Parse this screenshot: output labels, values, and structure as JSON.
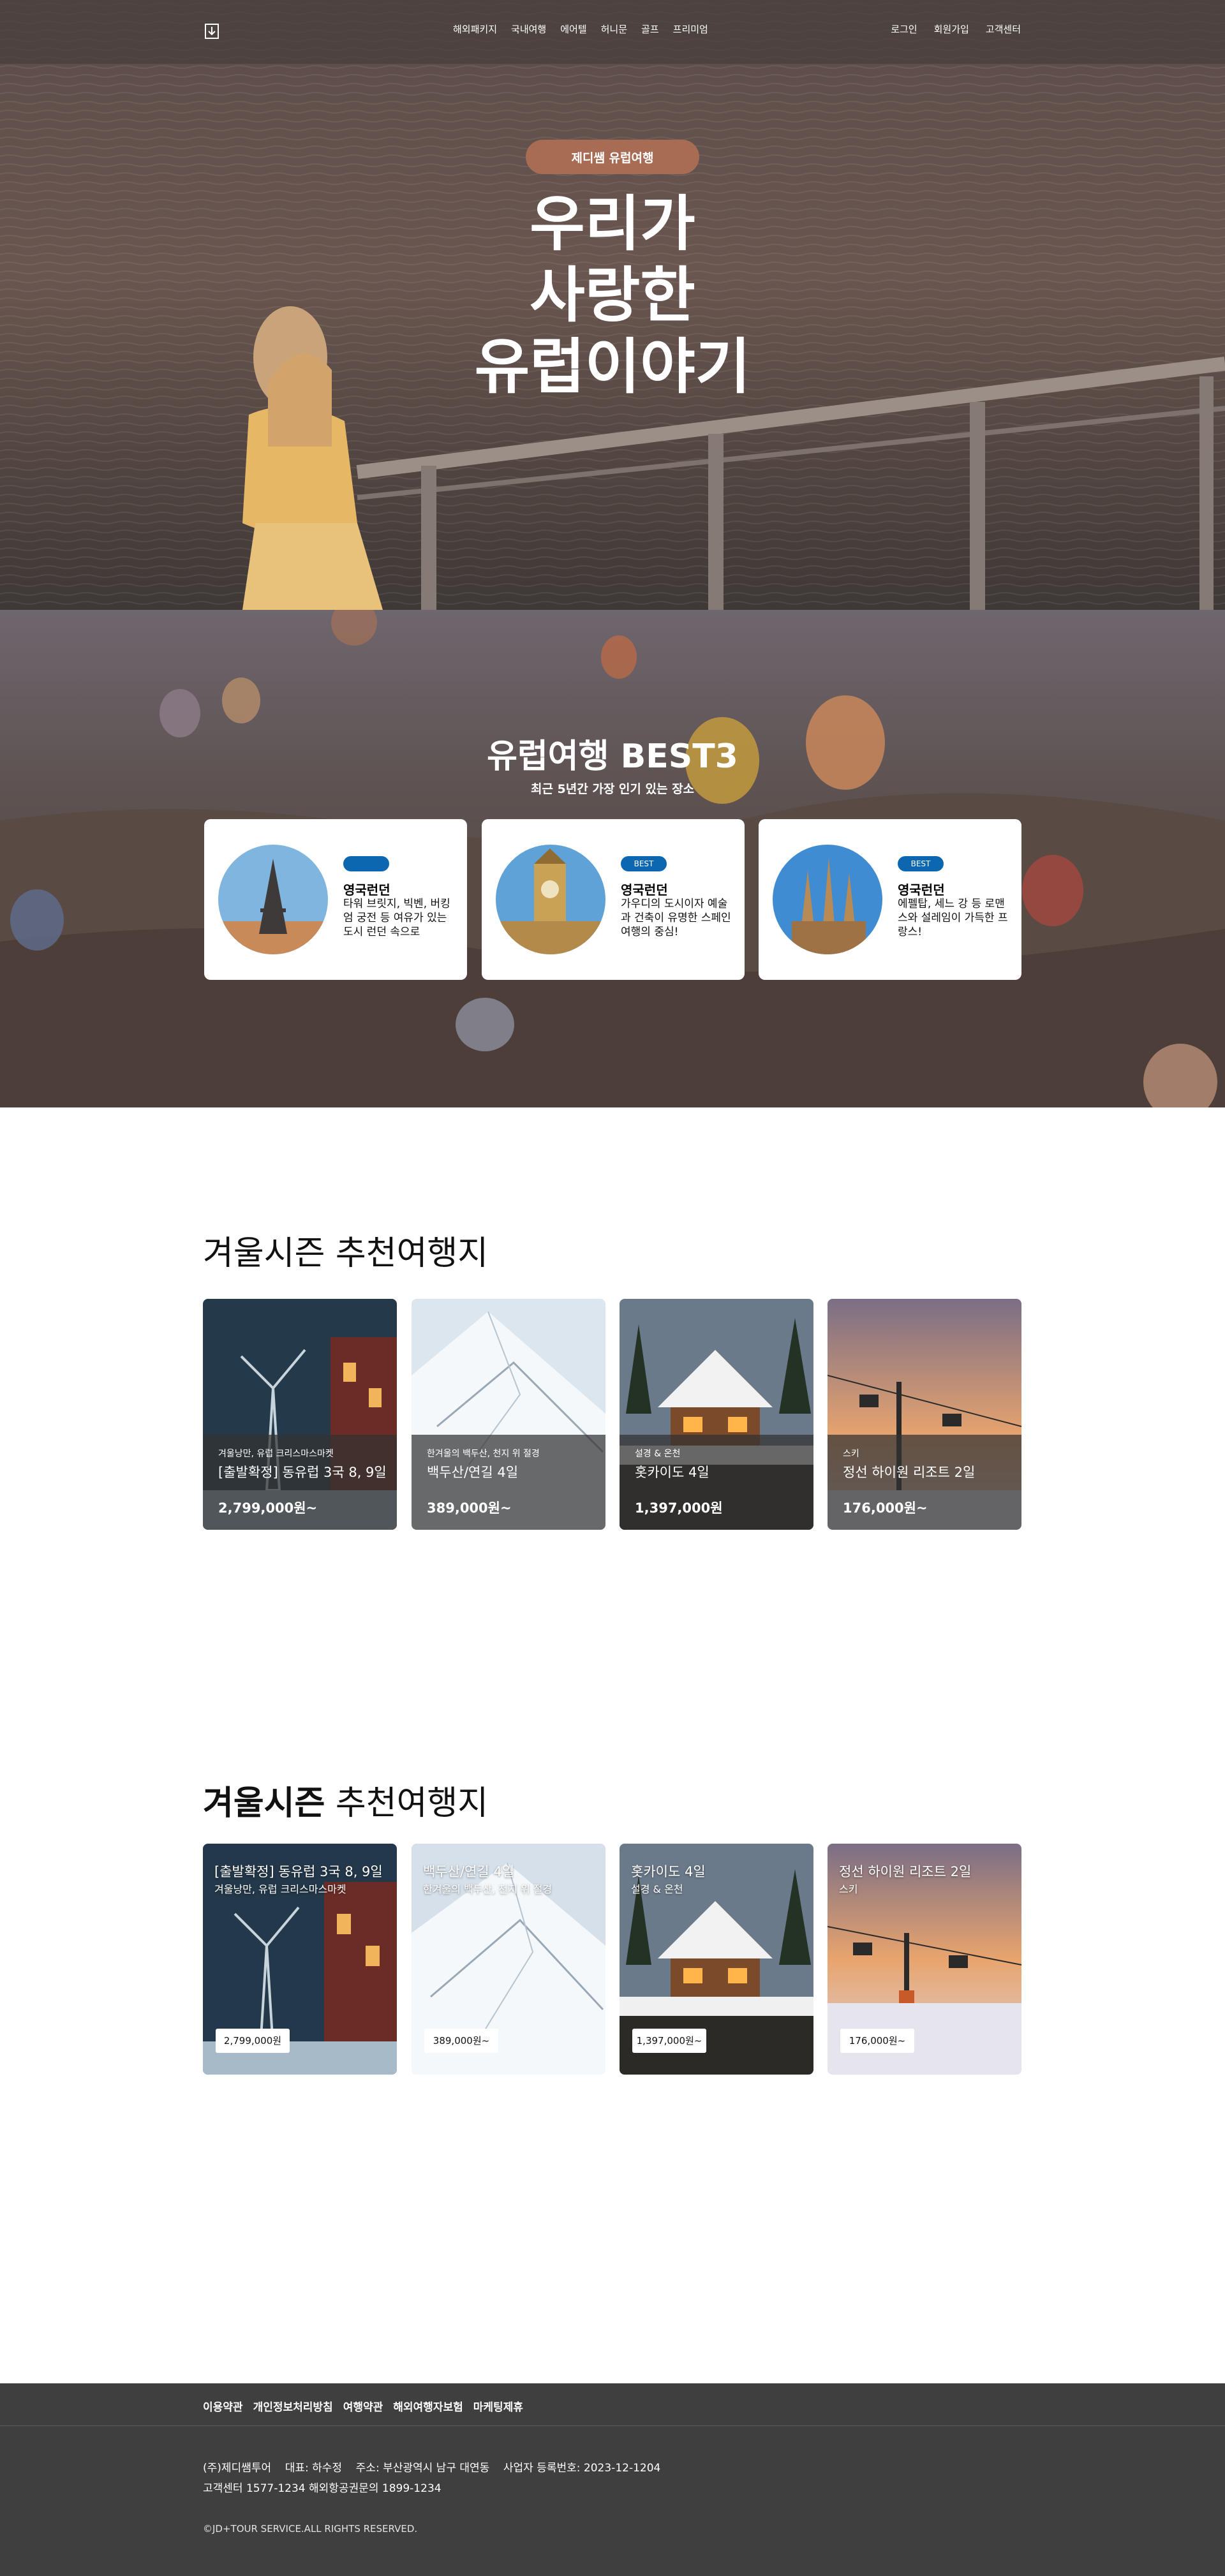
{
  "header": {
    "nav": [
      "해외패키지",
      "국내여행",
      "에어텔",
      "허니문",
      "골프",
      "프리미엄"
    ],
    "util": [
      "로그인",
      "회원가입",
      "고객센터"
    ]
  },
  "hero": {
    "badge": "제디쌤 유럽여행",
    "title_lines": [
      "우리가",
      "사랑한",
      "유럽이야기"
    ]
  },
  "best": {
    "title": "유럽여행 BEST3",
    "subtitle": "최근 5년간 가장 인기 있는 장소",
    "cards": [
      {
        "tag": "",
        "title": "영국런던",
        "desc": "타워 브릿지, 빅벤, 버킹엄 궁전 등 여유가 있는 도시 런던 속으로",
        "image": "eiffel-tower"
      },
      {
        "tag": "BEST",
        "title": "영국런던",
        "desc": "가우디의 도시이자 예술과 건축이 유명한 스페인 여행의 중심!",
        "image": "big-ben"
      },
      {
        "tag": "BEST",
        "title": "영국런던",
        "desc": "에펠탑, 세느 강 등 로맨스와 설레임이 가득한 프랑스!",
        "image": "sagrada-familia"
      }
    ]
  },
  "winter1": {
    "title": "겨울시즌 추천여행지",
    "cards": [
      {
        "category": "겨울낭만, 유럽 크리스마스마켓",
        "name": "[출발확정] 동유럽 3국 8, 9일",
        "price": "2,799,000원~"
      },
      {
        "category": "한겨울의 백두산, 천지 위 절경",
        "name": "백두산/연길 4일",
        "price": "389,000원~"
      },
      {
        "category": "설경 & 온천",
        "name": "홋카이도 4일",
        "price": "1,397,000원"
      },
      {
        "category": "스키",
        "name": "정선 하이원 리조트 2일",
        "price": "176,000원~"
      }
    ]
  },
  "winter2": {
    "title_bold": "겨울시즌",
    "title_rest": "추천여행지",
    "cards": [
      {
        "name": "[출발확정] 동유럽 3국 8, 9일",
        "category": "겨울낭만, 유럽 크리스마스마켓",
        "price": "2,799,000원"
      },
      {
        "name": "백두산/연길 4일",
        "category": "한겨울의 백두산, 천지 위 절경",
        "price": "389,000원~"
      },
      {
        "name": "홋카이도 4일",
        "category": "설경 & 온천",
        "price": "1,397,000원~"
      },
      {
        "name": "정선 하이원 리조트 2일",
        "category": "스키",
        "price": "176,000원~"
      }
    ]
  },
  "footer": {
    "links": [
      "이용약관",
      "개인정보처리방침",
      "여행약관",
      "해외여행자보험",
      "마케팅제휴"
    ],
    "company": "(주)제디쌤투어    대표: 하수정    주소: 부산광역시 남구 대연동    사업자 등록번호: 2023-12-1204",
    "contact": "고객센터 1577-1234 해외항공권문의 1899-1234",
    "copyright": "©JD+TOUR SERVICE.ALL RIGHTS RESERVED."
  },
  "colors": {
    "header_bg": "#463e3c",
    "badge": "#a86b54",
    "tag": "#0d66b0",
    "footer_bg": "#3f3f3f"
  }
}
